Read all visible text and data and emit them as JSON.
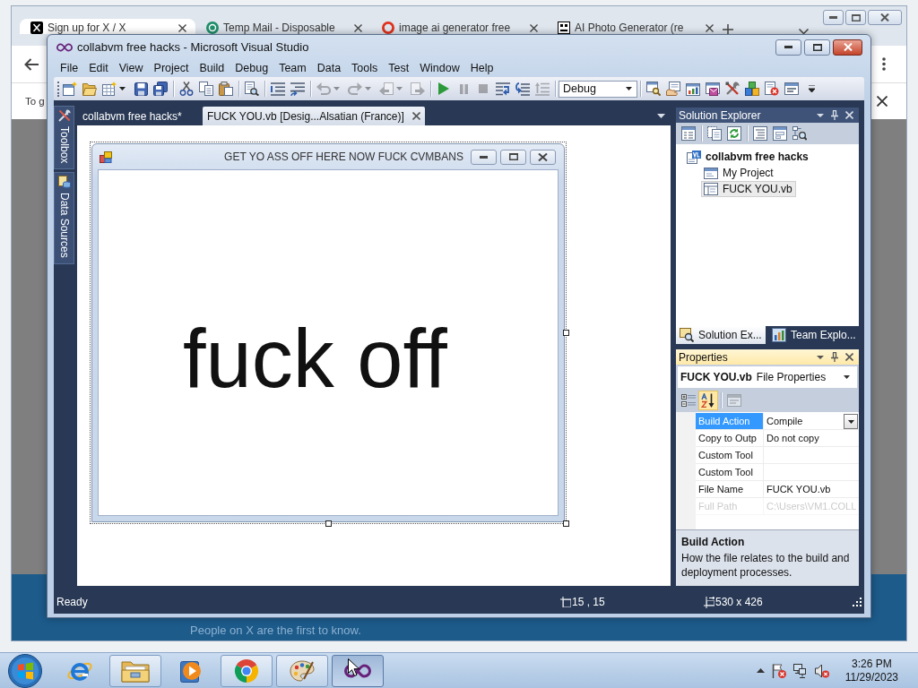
{
  "browser": {
    "tabs": [
      {
        "title": "Sign up for X / X",
        "kind": "x_logo",
        "selected": true
      },
      {
        "title": "Temp Mail - Disposable",
        "kind": "circle_logo",
        "selected": false
      },
      {
        "title": "image ai generator free",
        "kind": "ring_logo",
        "selected": false
      },
      {
        "title": "AI Photo Generator (re",
        "kind": "face_logo",
        "selected": false
      }
    ],
    "page_text": "To g",
    "banner_text": "People on X are the first to know."
  },
  "vs": {
    "title": "collabvm free hacks - Microsoft Visual Studio",
    "menu": [
      "File",
      "Edit",
      "View",
      "Project",
      "Build",
      "Debug",
      "Team",
      "Data",
      "Tools",
      "Test",
      "Window",
      "Help"
    ],
    "toolbar": [
      {
        "buttons": [
          {
            "kind": "new_project",
            "disabled": false
          },
          {
            "kind": "open",
            "disabled": false
          },
          {
            "kind": "add_item",
            "disabled": false,
            "dropdown": true
          },
          {
            "kind": "save",
            "disabled": false
          },
          {
            "kind": "save_all",
            "disabled": false
          }
        ]
      },
      {
        "buttons": [
          {
            "kind": "cut",
            "disabled": false
          },
          {
            "kind": "copy",
            "disabled": false
          },
          {
            "kind": "paste",
            "disabled": false
          }
        ]
      },
      {
        "buttons": [
          {
            "kind": "find",
            "disabled": false
          }
        ]
      },
      {
        "buttons": [
          {
            "kind": "comment",
            "disabled": false
          },
          {
            "kind": "uncomment",
            "disabled": false
          }
        ]
      },
      {
        "buttons": [
          {
            "kind": "undo",
            "disabled": true,
            "dropdown": true
          },
          {
            "kind": "redo",
            "disabled": true,
            "dropdown": true
          },
          {
            "kind": "navigate_back",
            "disabled": true,
            "dropdown": true
          },
          {
            "kind": "navigate_forward",
            "disabled": true
          }
        ]
      },
      {
        "buttons": [
          {
            "kind": "start",
            "disabled": false
          },
          {
            "kind": "break_all",
            "disabled": true
          },
          {
            "kind": "stop",
            "disabled": true
          },
          {
            "kind": "step_into",
            "disabled": false
          },
          {
            "kind": "step_over",
            "disabled": false
          },
          {
            "kind": "step_out",
            "disabled": true
          }
        ]
      },
      {
        "buttons": [
          {
            "kind": "combo",
            "value": "Debug",
            "disabled": false
          }
        ]
      },
      {
        "buttons": [
          {
            "kind": "find_symbol",
            "disabled": false
          },
          {
            "kind": "properties",
            "disabled": false
          },
          {
            "kind": "object_browser",
            "disabled": false
          },
          {
            "kind": "extension",
            "disabled": false
          },
          {
            "kind": "tools",
            "disabled": false
          },
          {
            "kind": "toolbox",
            "disabled": false
          },
          {
            "kind": "error_doc",
            "disabled": false
          },
          {
            "kind": "command_window",
            "disabled": false
          }
        ]
      }
    ],
    "side_tabs": [
      "Toolbox",
      "Data Sources"
    ],
    "doc_tabs": [
      {
        "label": "collabvm free hacks*",
        "selected": false
      },
      {
        "label": "FUCK YOU.vb [Desig...Alsatian (France)]",
        "selected": true
      }
    ],
    "form": {
      "title": "GET YO ASS OFF HERE NOW FUCK CVMBANS",
      "label": "fuck off"
    },
    "solution_explorer": {
      "title": "Solution Explorer",
      "tree": [
        {
          "label": "collabvm free hacks",
          "kind": "project",
          "selected": false,
          "children": [
            {
              "label": "My Project",
              "kind": "my_project",
              "selected": false
            },
            {
              "label": "FUCK YOU.vb",
              "kind": "vb_file",
              "selected": true
            }
          ]
        }
      ],
      "tabs": [
        {
          "label": "Solution Ex...",
          "kind": "solution",
          "selected": true
        },
        {
          "label": "Team Explo...",
          "kind": "team",
          "selected": false
        }
      ]
    },
    "properties": {
      "title": "Properties",
      "object_name": "FUCK YOU.vb",
      "object_type": "File Properties",
      "alphabetical": true,
      "property_pages_disabled": true,
      "rows": [
        {
          "name": "Build Action",
          "value": "Compile",
          "selected": true,
          "disabled": false
        },
        {
          "name": "Copy to Outp",
          "value": "Do not copy",
          "selected": false,
          "disabled": false
        },
        {
          "name": "Custom Tool",
          "selected": false,
          "disabled": false
        },
        {
          "name": "Custom Tool",
          "selected": false,
          "disabled": false
        },
        {
          "name": "File Name",
          "value": "FUCK YOU.vb",
          "selected": false,
          "disabled": false
        },
        {
          "name": "Full Path",
          "value": "C:\\Users\\VM1.COLL",
          "selected": false,
          "disabled": true
        }
      ],
      "description_title": "Build Action",
      "description": "How the file relates to the build and deployment processes."
    },
    "status_bar": {
      "text": "Ready",
      "position": "15 , 15",
      "size": "530 x 426"
    }
  },
  "taskbar": {
    "apps": [
      {
        "kind": "ie",
        "running": false,
        "selected": false
      },
      {
        "kind": "explorer",
        "running": true,
        "selected": false
      },
      {
        "kind": "media_player",
        "running": false,
        "selected": false
      },
      {
        "kind": "chrome",
        "running": true,
        "selected": false
      },
      {
        "kind": "paint",
        "running": true,
        "selected": false
      },
      {
        "kind": "visual_studio",
        "running": true,
        "selected": true
      }
    ],
    "time": "3:26 PM",
    "date": "11/29/2023"
  }
}
